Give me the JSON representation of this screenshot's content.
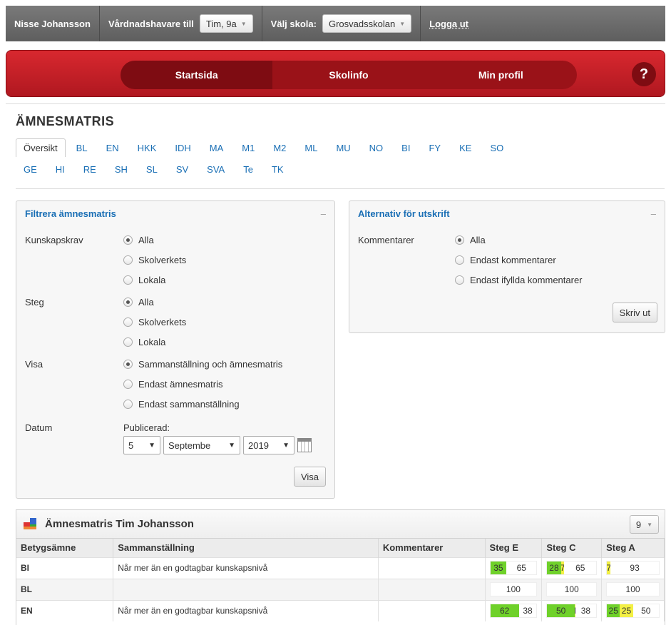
{
  "topbar": {
    "user": "Nisse Johansson",
    "guardian_label": "Vårdnadshavare till",
    "guardian_value": "Tim, 9a",
    "school_label": "Välj skola:",
    "school_value": "Grosvadsskolan",
    "logout": "Logga ut"
  },
  "nav": {
    "items": [
      "Startsida",
      "Skolinfo",
      "Min profil"
    ],
    "help": "?"
  },
  "page": {
    "title": "ÄMNESMATRIS"
  },
  "subjects": {
    "row1": [
      "Översikt",
      "BL",
      "EN",
      "HKK",
      "IDH",
      "MA",
      "M1",
      "M2",
      "ML",
      "MU",
      "NO",
      "BI",
      "FY",
      "KE",
      "SO"
    ],
    "row2": [
      "GE",
      "HI",
      "RE",
      "SH",
      "SL",
      "SV",
      "SVA",
      "Te",
      "TK"
    ]
  },
  "filter": {
    "title": "Filtrera ämnesmatris",
    "minimize": "–",
    "kunskapskrav": {
      "label": "Kunskapskrav",
      "options": [
        "Alla",
        "Skolverkets",
        "Lokala"
      ]
    },
    "steg": {
      "label": "Steg",
      "options": [
        "Alla",
        "Skolverkets",
        "Lokala"
      ]
    },
    "visa": {
      "label": "Visa",
      "options": [
        "Sammanställning och ämnesmatris",
        "Endast ämnesmatris",
        "Endast sammanställning"
      ]
    },
    "datum": {
      "label": "Datum",
      "sublabel": "Publicerad:",
      "day": "5",
      "month": "Septembe",
      "year": "2019"
    },
    "button": "Visa"
  },
  "print": {
    "title": "Alternativ för utskrift",
    "minimize": "–",
    "label": "Kommentarer",
    "options": [
      "Alla",
      "Endast kommentarer",
      "Endast ifyllda kommentarer"
    ],
    "button": "Skriv ut"
  },
  "matrix": {
    "title": "Ämnesmatris Tim Johansson",
    "grade_select": "9",
    "columns": [
      "Betygsämne",
      "Sammanställning",
      "Kommentarer",
      "Steg E",
      "Steg C",
      "Steg A"
    ],
    "rows": [
      {
        "subject": "BI",
        "summary": "Når mer än en godtagbar kunskapsnivå",
        "comment": "",
        "e": [
          [
            "g",
            "35"
          ],
          [
            "w",
            "65"
          ]
        ],
        "c": [
          [
            "g",
            "28"
          ],
          [
            "y",
            "7"
          ],
          [
            "w",
            "65"
          ]
        ],
        "a": [
          [
            "y",
            "7"
          ],
          [
            "w",
            "93"
          ]
        ]
      },
      {
        "subject": "BL",
        "summary": "",
        "comment": "",
        "e": [
          [
            "w",
            "100"
          ]
        ],
        "c": [
          [
            "w",
            "100"
          ]
        ],
        "a": [
          [
            "w",
            "100"
          ]
        ]
      },
      {
        "subject": "EN",
        "summary": "Når mer än en godtagbar kunskapsnivå",
        "comment": "",
        "e": [
          [
            "g",
            "62"
          ],
          [
            "w",
            "38"
          ]
        ],
        "c": [
          [
            "g",
            "50"
          ],
          [
            "y",
            "1"
          ],
          [
            "w",
            "38"
          ]
        ],
        "a": [
          [
            "g",
            "25"
          ],
          [
            "y",
            "25"
          ],
          [
            "w",
            "50"
          ]
        ]
      }
    ]
  },
  "colors": {
    "red": "#c41e25",
    "link": "#1a6fb5",
    "green": "#6fd12a",
    "yellow": "#f3f044"
  }
}
